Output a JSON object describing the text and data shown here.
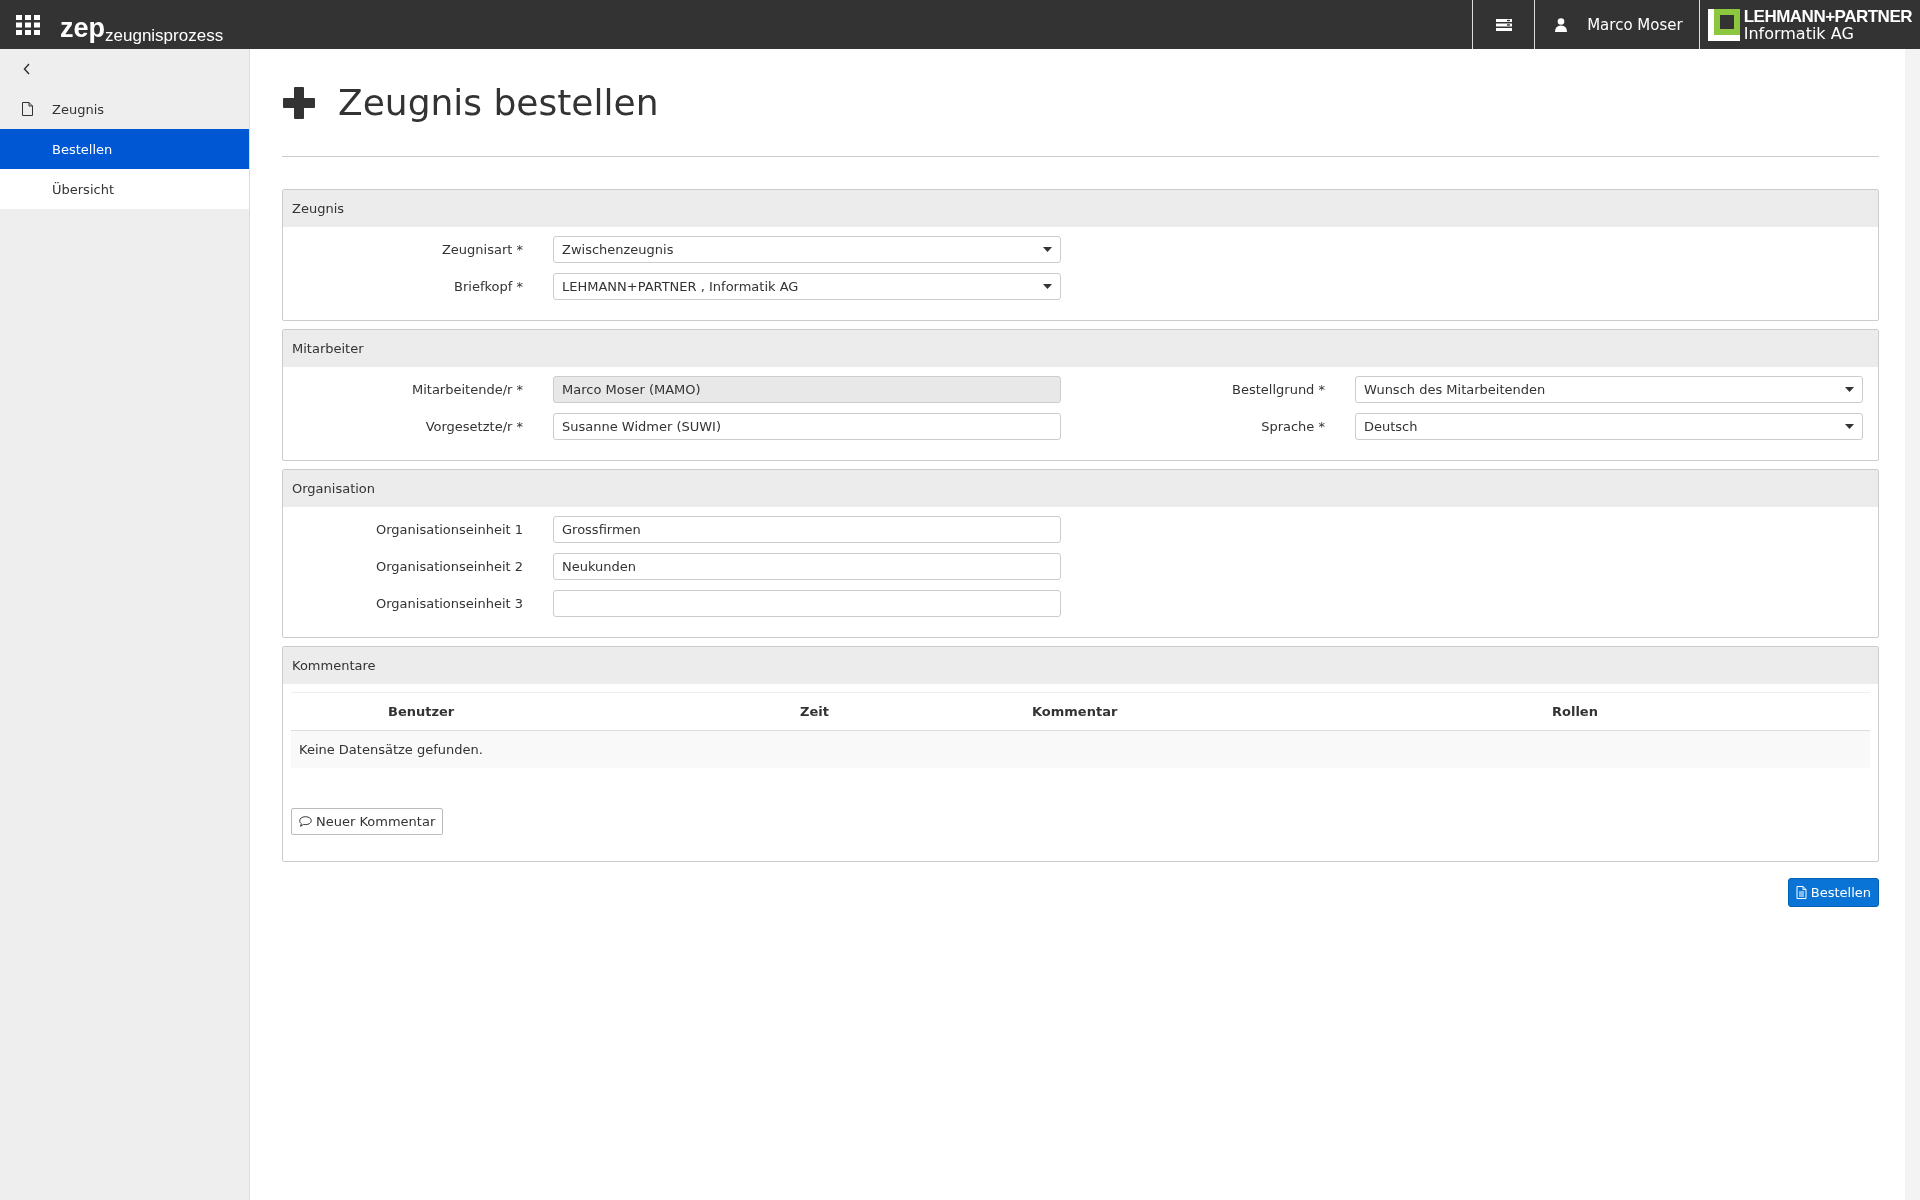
{
  "topbar": {
    "app_name": "zep",
    "app_subtitle": "zeugnisprozess",
    "user_name": "Marco Moser",
    "company_line_1": "LEHMANN+PARTNER",
    "company_line_2": "Informatik AG"
  },
  "sidebar": {
    "items": [
      {
        "label": "Zeugnis",
        "kind": "group",
        "selected": false
      },
      {
        "label": "Bestellen",
        "kind": "link",
        "selected": true
      },
      {
        "label": "Übersicht",
        "kind": "link",
        "selected": false
      }
    ]
  },
  "page_title": "Zeugnis bestellen",
  "panels": [
    {
      "title": "Zeugnis",
      "left_fields": [
        {
          "label": "Zeugnisart *",
          "value": "Zwischenzeugnis",
          "kind": "select",
          "disabled": false
        },
        {
          "label": "Briefkopf *",
          "value": "LEHMANN+PARTNER , Informatik AG",
          "kind": "select",
          "disabled": false
        }
      ]
    },
    {
      "title": "Mitarbeiter",
      "left_fields": [
        {
          "label": "Mitarbeitende/r *",
          "value": "Marco Moser (MAMO)",
          "kind": "text",
          "disabled": true
        },
        {
          "label": "Vorgesetzte/r *",
          "value": "Susanne Widmer (SUWI)",
          "kind": "text",
          "disabled": false
        }
      ],
      "right_fields": [
        {
          "label": "Bestellgrund *",
          "value": "Wunsch des Mitarbeitenden",
          "kind": "select",
          "disabled": false
        },
        {
          "label": "Sprache *",
          "value": "Deutsch",
          "kind": "select",
          "disabled": false
        }
      ]
    },
    {
      "title": "Organisation",
      "left_fields": [
        {
          "label": "Organisationseinheit 1",
          "value": "Grossfirmen",
          "kind": "text",
          "disabled": false
        },
        {
          "label": "Organisationseinheit 2",
          "value": "Neukunden",
          "kind": "text",
          "disabled": false
        },
        {
          "label": "Organisationseinheit 3",
          "kind": "text",
          "disabled": false
        }
      ]
    }
  ],
  "comments": {
    "title": "Kommentare",
    "columns": [
      "Benutzer",
      "Zeit",
      "Kommentar",
      "Rollen"
    ],
    "empty_message": "Keine Datensätze gefunden.",
    "new_button": "Neuer Kommentar"
  },
  "submit_button": "Bestellen"
}
